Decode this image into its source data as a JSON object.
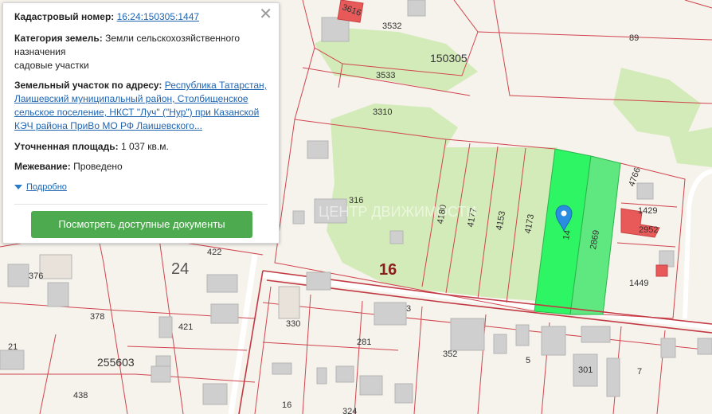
{
  "map": {
    "quarter_label": "150305",
    "block_label": "16",
    "block_label_2": "24",
    "quarter_label_2": "255603",
    "parcels": {
      "p3532": "3532",
      "p3533": "3533",
      "p3310": "3310",
      "p89": "89",
      "p3616": "3616",
      "p316": "316",
      "p4180": "4180",
      "p4177": "4177",
      "p4153": "4153",
      "p4173": "4173",
      "p2869": "2869",
      "p4766": "4766",
      "p1429": "1429",
      "p2952": "2952",
      "p1449": "1449",
      "p376": "376",
      "p422": "422",
      "p378": "378",
      "p421": "421",
      "p21": "21",
      "p438": "438",
      "p330": "330",
      "p3": "3",
      "p281": "281",
      "p352": "352",
      "p5": "5",
      "p301": "301",
      "p7": "7",
      "p16": "16",
      "p324": "324",
      "p1447": "14"
    },
    "watermark": "ЦЕНТР ДВИЖИМОСТИ",
    "colors": {
      "background": "#f6f2ec",
      "parcel_border": "#d0454e",
      "green_area": "#d3ebb8",
      "highlight": "#2ef563",
      "highlight_2": "#5fe880",
      "building": "#cfcfcf",
      "building_red": "#e85a5a",
      "road": "#e6ddd5"
    },
    "pin_icon": "map-pin-icon"
  },
  "popup": {
    "cadastral_label": "Кадастровый номер:",
    "cadastral_value": "16:24:150305:1447",
    "category_label": "Категория земель:",
    "category_value": "Земли сельскохозяйственного назначения",
    "category_use": "садовые участки",
    "address_label": "Земельный участок по адресу:",
    "address_value": "Республика Татарстан, Лаишевский муниципальный район, Столбищенское сельское поселение, НКСТ \"Луч\" (\"Нур\") при Казанской КЭЧ района ПриВо МО РФ Лаишевского...",
    "area_label": "Уточненная площадь:",
    "area_value": "1 037 кв.м.",
    "survey_label": "Межевание:",
    "survey_value": "Проведено",
    "details_link": "Подробно",
    "docs_button": "Посмотреть доступные документы",
    "close_icon": "close-icon"
  }
}
